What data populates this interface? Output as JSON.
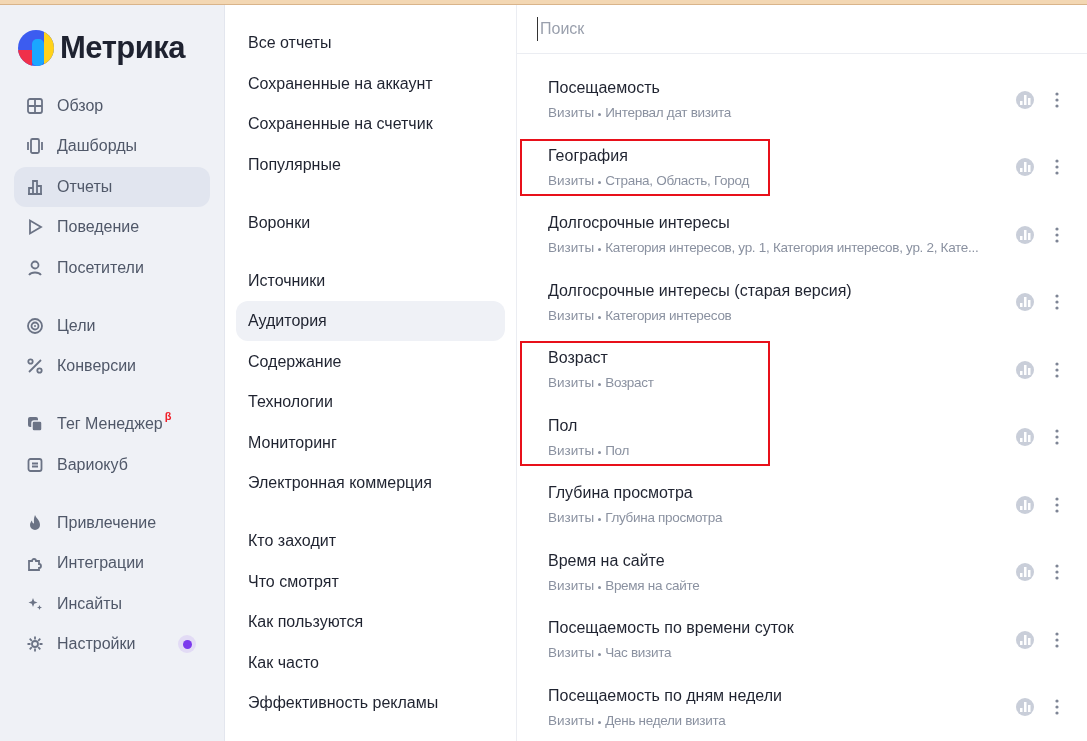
{
  "logo": {
    "text": "Метрика"
  },
  "sidebar": {
    "groups": [
      {
        "items": [
          {
            "label": "Обзор",
            "selected": false
          },
          {
            "label": "Дашборды",
            "selected": false
          },
          {
            "label": "Отчеты",
            "selected": true
          },
          {
            "label": "Поведение",
            "selected": false
          },
          {
            "label": "Посетители",
            "selected": false
          }
        ]
      },
      {
        "items": [
          {
            "label": "Цели",
            "selected": false
          },
          {
            "label": "Конверсии",
            "selected": false
          }
        ]
      },
      {
        "items": [
          {
            "label": "Тег Менеджер",
            "badge": "β",
            "selected": false
          },
          {
            "label": "Вариокуб",
            "selected": false
          }
        ]
      },
      {
        "items": [
          {
            "label": "Привлечение",
            "selected": false
          },
          {
            "label": "Интеграции",
            "selected": false
          },
          {
            "label": "Инсайты",
            "selected": false
          },
          {
            "label": "Настройки",
            "selected": false,
            "notification": true
          }
        ]
      }
    ]
  },
  "categories": {
    "groups": [
      {
        "items": [
          {
            "label": "Все отчеты",
            "selected": false
          },
          {
            "label": "Сохраненные на аккаунт",
            "selected": false
          },
          {
            "label": "Сохраненные на счетчик",
            "selected": false
          },
          {
            "label": "Популярные",
            "selected": false
          }
        ]
      },
      {
        "items": [
          {
            "label": "Воронки",
            "selected": false
          }
        ]
      },
      {
        "items": [
          {
            "label": "Источники",
            "selected": false
          },
          {
            "label": "Аудитория",
            "selected": true
          },
          {
            "label": "Содержание",
            "selected": false
          },
          {
            "label": "Технологии",
            "selected": false
          },
          {
            "label": "Мониторинг",
            "selected": false
          },
          {
            "label": "Электронная коммерция",
            "selected": false
          }
        ]
      },
      {
        "items": [
          {
            "label": "Кто заходит",
            "selected": false
          },
          {
            "label": "Что смотрят",
            "selected": false
          },
          {
            "label": "Как пользуются",
            "selected": false
          },
          {
            "label": "Как часто",
            "selected": false
          },
          {
            "label": "Эффективность рекламы",
            "selected": false
          }
        ]
      }
    ]
  },
  "search": {
    "placeholder": "Поиск"
  },
  "report_groups": [
    {
      "highlighted": false,
      "reports": [
        {
          "title": "Посещаемость",
          "metric": "Визиты",
          "dimensions": "Интервал дат визита"
        }
      ]
    },
    {
      "highlighted": true,
      "reports": [
        {
          "title": "География",
          "metric": "Визиты",
          "dimensions": "Страна, Область, Город"
        }
      ]
    },
    {
      "highlighted": false,
      "reports": [
        {
          "title": "Долгосрочные интересы",
          "metric": "Визиты",
          "dimensions": "Категория интересов, ур. 1, Категория интересов, ур. 2, Кате..."
        },
        {
          "title": "Долгосрочные интересы (старая версия)",
          "metric": "Визиты",
          "dimensions": "Категория интересов"
        }
      ]
    },
    {
      "highlighted": true,
      "reports": [
        {
          "title": "Возраст",
          "metric": "Визиты",
          "dimensions": "Возраст"
        },
        {
          "title": "Пол",
          "metric": "Визиты",
          "dimensions": "Пол"
        }
      ]
    },
    {
      "highlighted": false,
      "reports": [
        {
          "title": "Глубина просмотра",
          "metric": "Визиты",
          "dimensions": "Глубина просмотра"
        },
        {
          "title": "Время на сайте",
          "metric": "Визиты",
          "dimensions": "Время на сайте"
        },
        {
          "title": "Посещаемость по времени суток",
          "metric": "Визиты",
          "dimensions": "Час визита"
        },
        {
          "title": "Посещаемость по дням недели",
          "metric": "Визиты",
          "dimensions": "День недели визита"
        }
      ]
    }
  ]
}
